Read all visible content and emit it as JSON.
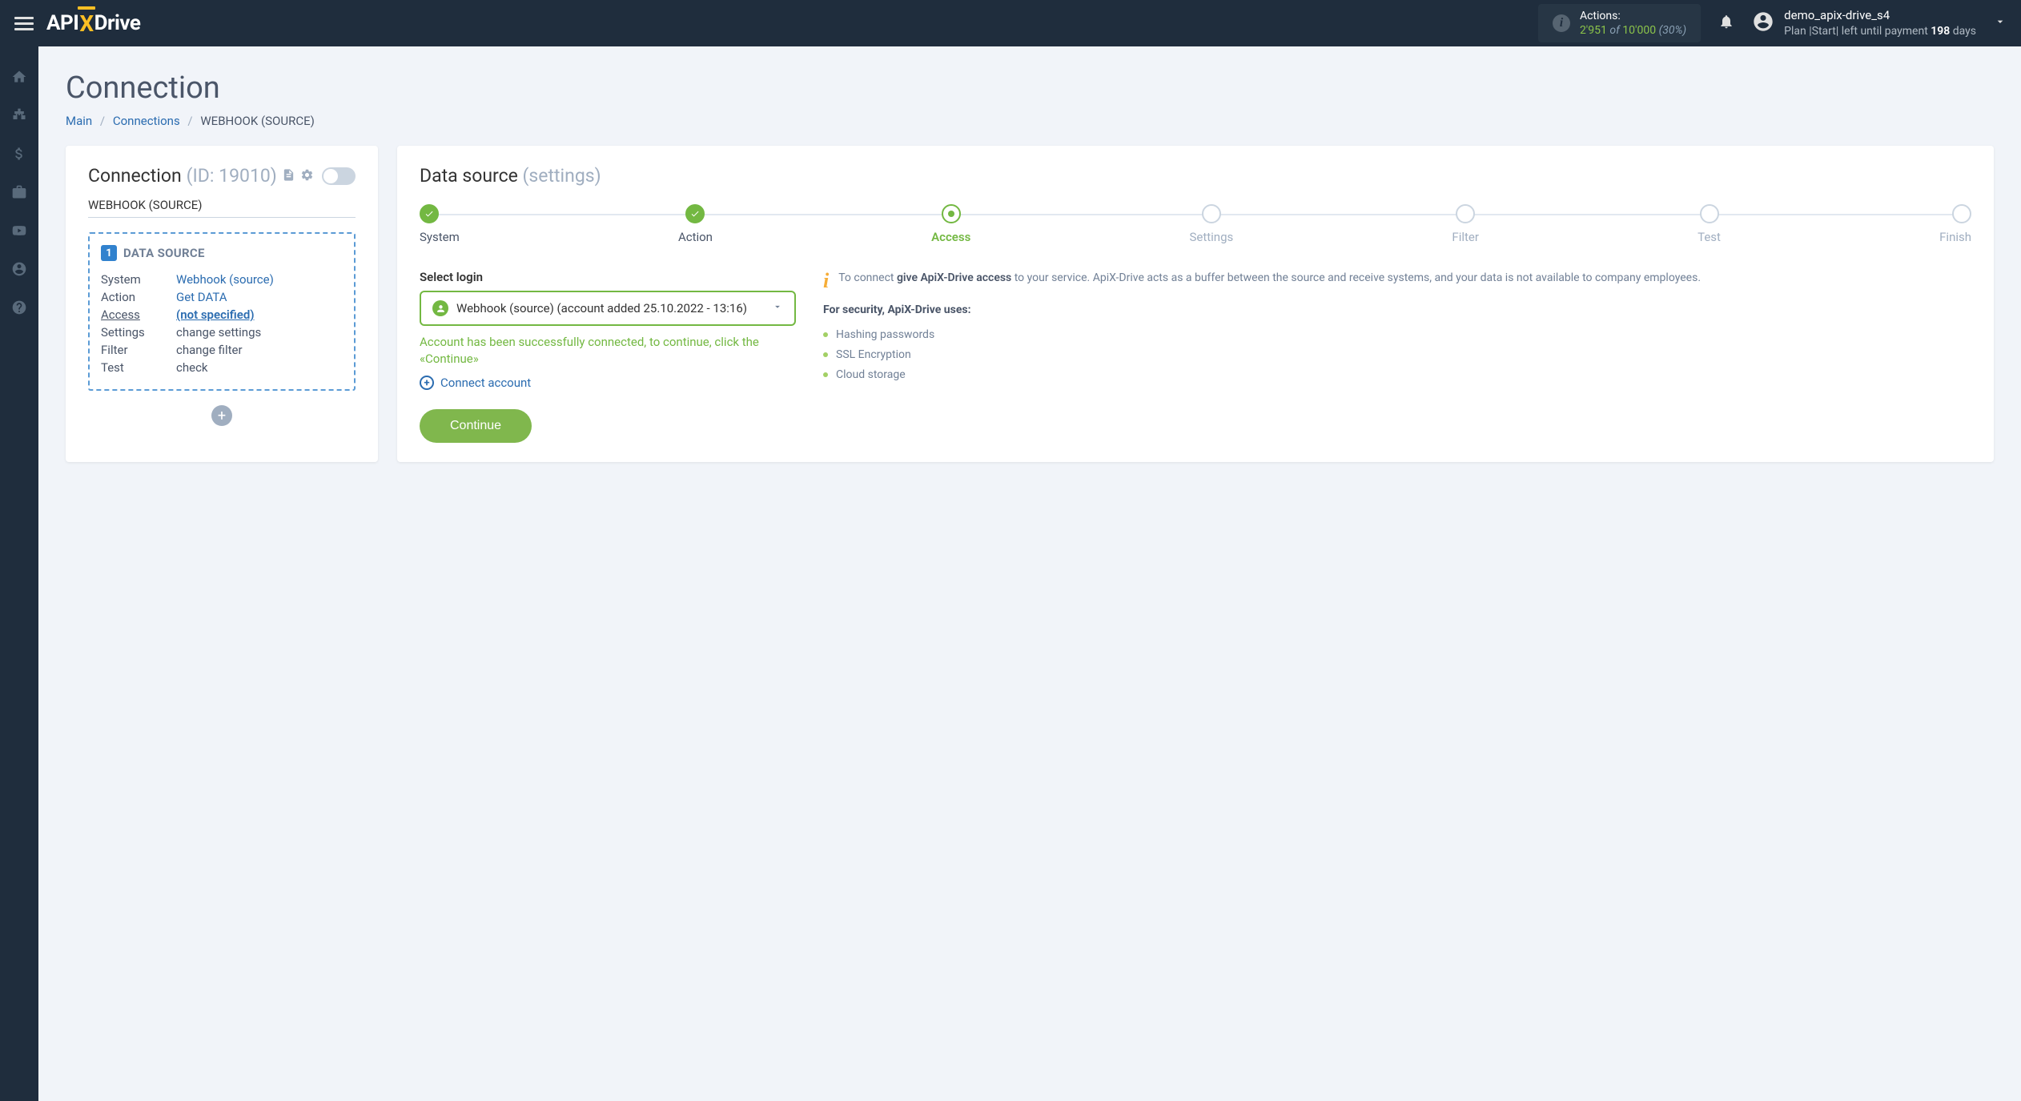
{
  "header": {
    "logo": {
      "part1": "API",
      "x": "X",
      "part2": "Drive"
    },
    "actions": {
      "label": "Actions:",
      "used": "2'951",
      "of": "of",
      "total": "10'000",
      "pct": "(30%)"
    },
    "user": {
      "name": "demo_apix-drive_s4",
      "plan_prefix": "Plan |Start| left until payment ",
      "days": "198",
      "days_suffix": " days"
    }
  },
  "page": {
    "title": "Connection",
    "breadcrumb": {
      "main": "Main",
      "connections": "Connections",
      "current": "WEBHOOK (SOURCE)"
    }
  },
  "left_panel": {
    "title": "Connection",
    "id_label": "(ID: 19010)",
    "subtitle": "WEBHOOK (SOURCE)",
    "box_badge": "1",
    "box_title": "DATA SOURCE",
    "rows": {
      "system": {
        "label": "System",
        "value": "Webhook (source)"
      },
      "action": {
        "label": "Action",
        "value": "Get DATA"
      },
      "access": {
        "label": "Access",
        "value": "(not specified)"
      },
      "settings": {
        "label": "Settings",
        "value": "change settings"
      },
      "filter": {
        "label": "Filter",
        "value": "change filter"
      },
      "test": {
        "label": "Test",
        "value": "check"
      }
    }
  },
  "right_panel": {
    "title": "Data source",
    "title_muted": "(settings)",
    "steps": [
      "System",
      "Action",
      "Access",
      "Settings",
      "Filter",
      "Test",
      "Finish"
    ],
    "select_label": "Select login",
    "select_value": "Webhook (source) (account added 25.10.2022 - 13:16)",
    "success_msg": "Account has been successfully connected, to continue, click the «Continue»",
    "connect_label": "Connect account",
    "continue_label": "Continue",
    "info": {
      "prefix": "To connect ",
      "bold": "give ApiX-Drive access",
      "suffix": " to your service. ApiX-Drive acts as a buffer between the source and receive systems, and your data is not available to company employees."
    },
    "security_head": "For security, ApiX-Drive uses:",
    "security_items": [
      "Hashing passwords",
      "SSL Encryption",
      "Cloud storage"
    ]
  }
}
